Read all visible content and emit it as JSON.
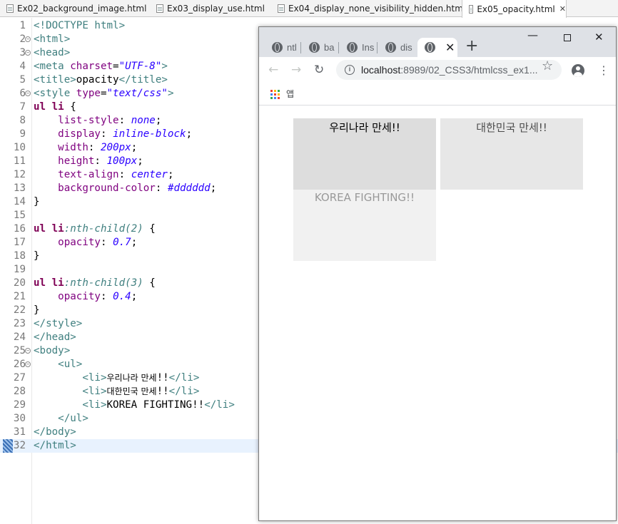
{
  "editor_tabs": [
    {
      "label": "Ex02_background_image.html",
      "active": false
    },
    {
      "label": "Ex03_display_use.html",
      "active": false
    },
    {
      "label": "Ex04_display_none_visibility_hidden.html",
      "active": false
    },
    {
      "label": "Ex05_opacity.html",
      "active": true,
      "close": "✕"
    }
  ],
  "code_lines": [
    {
      "n": "1",
      "fold": false,
      "parts": [
        [
          "t-tag",
          "<!DOCTYPE html>"
        ]
      ]
    },
    {
      "n": "2",
      "fold": true,
      "parts": [
        [
          "t-tag",
          "<html>"
        ]
      ]
    },
    {
      "n": "3",
      "fold": true,
      "parts": [
        [
          "t-tag",
          "<head>"
        ]
      ]
    },
    {
      "n": "4",
      "fold": false,
      "parts": [
        [
          "t-tag",
          "<meta "
        ],
        [
          "t-attr",
          "charset"
        ],
        [
          "t-txt",
          "="
        ],
        [
          "t-str",
          "\"UTF-8\""
        ],
        [
          "t-tag",
          ">"
        ]
      ]
    },
    {
      "n": "5",
      "fold": false,
      "parts": [
        [
          "t-tag",
          "<title>"
        ],
        [
          "t-txt",
          "opacity"
        ],
        [
          "t-tag",
          "</title>"
        ]
      ]
    },
    {
      "n": "6",
      "fold": true,
      "parts": [
        [
          "t-tag",
          "<style "
        ],
        [
          "t-attr",
          "type"
        ],
        [
          "t-txt",
          "="
        ],
        [
          "t-str",
          "\"text/css\""
        ],
        [
          "t-tag",
          ">"
        ]
      ]
    },
    {
      "n": "7",
      "fold": false,
      "parts": [
        [
          "t-sel",
          "ul li"
        ],
        [
          "t-txt",
          " {"
        ]
      ]
    },
    {
      "n": "8",
      "fold": false,
      "parts": [
        [
          "t-txt",
          "    "
        ],
        [
          "t-prop",
          "list-style"
        ],
        [
          "t-txt",
          ": "
        ],
        [
          "t-val",
          "none"
        ],
        [
          "t-txt",
          ";"
        ]
      ]
    },
    {
      "n": "9",
      "fold": false,
      "parts": [
        [
          "t-txt",
          "    "
        ],
        [
          "t-prop",
          "display"
        ],
        [
          "t-txt",
          ": "
        ],
        [
          "t-val",
          "inline-block"
        ],
        [
          "t-txt",
          ";"
        ]
      ]
    },
    {
      "n": "10",
      "fold": false,
      "parts": [
        [
          "t-txt",
          "    "
        ],
        [
          "t-prop",
          "width"
        ],
        [
          "t-txt",
          ": "
        ],
        [
          "t-val",
          "200px"
        ],
        [
          "t-txt",
          ";"
        ]
      ]
    },
    {
      "n": "11",
      "fold": false,
      "parts": [
        [
          "t-txt",
          "    "
        ],
        [
          "t-prop",
          "height"
        ],
        [
          "t-txt",
          ": "
        ],
        [
          "t-val",
          "100px"
        ],
        [
          "t-txt",
          ";"
        ]
      ]
    },
    {
      "n": "12",
      "fold": false,
      "parts": [
        [
          "t-txt",
          "    "
        ],
        [
          "t-prop",
          "text-align"
        ],
        [
          "t-txt",
          ": "
        ],
        [
          "t-val",
          "center"
        ],
        [
          "t-txt",
          ";"
        ]
      ]
    },
    {
      "n": "13",
      "fold": false,
      "parts": [
        [
          "t-txt",
          "    "
        ],
        [
          "t-prop",
          "background-color"
        ],
        [
          "t-txt",
          ": "
        ],
        [
          "t-val",
          "#dddddd"
        ],
        [
          "t-txt",
          ";"
        ]
      ]
    },
    {
      "n": "14",
      "fold": false,
      "parts": [
        [
          "t-txt",
          "}"
        ]
      ]
    },
    {
      "n": "15",
      "fold": false,
      "parts": []
    },
    {
      "n": "16",
      "fold": false,
      "parts": [
        [
          "t-sel",
          "ul li"
        ],
        [
          "t-pseudo",
          ":nth-child(2)"
        ],
        [
          "t-txt",
          " {"
        ]
      ]
    },
    {
      "n": "17",
      "fold": false,
      "parts": [
        [
          "t-txt",
          "    "
        ],
        [
          "t-prop",
          "opacity"
        ],
        [
          "t-txt",
          ": "
        ],
        [
          "t-val",
          "0.7"
        ],
        [
          "t-txt",
          ";"
        ]
      ]
    },
    {
      "n": "18",
      "fold": false,
      "parts": [
        [
          "t-txt",
          "}"
        ]
      ]
    },
    {
      "n": "19",
      "fold": false,
      "parts": []
    },
    {
      "n": "20",
      "fold": false,
      "parts": [
        [
          "t-sel",
          "ul li"
        ],
        [
          "t-pseudo",
          ":nth-child(3)"
        ],
        [
          "t-txt",
          " {"
        ]
      ]
    },
    {
      "n": "21",
      "fold": false,
      "parts": [
        [
          "t-txt",
          "    "
        ],
        [
          "t-prop",
          "opacity"
        ],
        [
          "t-txt",
          ": "
        ],
        [
          "t-val",
          "0.4"
        ],
        [
          "t-txt",
          ";"
        ]
      ]
    },
    {
      "n": "22",
      "fold": false,
      "parts": [
        [
          "t-txt",
          "}"
        ]
      ]
    },
    {
      "n": "23",
      "fold": false,
      "parts": [
        [
          "t-tag",
          "</style>"
        ]
      ]
    },
    {
      "n": "24",
      "fold": false,
      "parts": [
        [
          "t-tag",
          "</head>"
        ]
      ]
    },
    {
      "n": "25",
      "fold": true,
      "parts": [
        [
          "t-tag",
          "<body>"
        ]
      ]
    },
    {
      "n": "26",
      "fold": true,
      "parts": [
        [
          "t-txt",
          "    "
        ],
        [
          "t-tag",
          "<ul>"
        ]
      ]
    },
    {
      "n": "27",
      "fold": false,
      "parts": [
        [
          "t-txt",
          "        "
        ],
        [
          "t-tag",
          "<li>"
        ],
        [
          "t-txt t-kr",
          "우리나라 만세"
        ],
        [
          "t-txt",
          "!!"
        ],
        [
          "t-tag",
          "</li>"
        ]
      ]
    },
    {
      "n": "28",
      "fold": false,
      "parts": [
        [
          "t-txt",
          "        "
        ],
        [
          "t-tag",
          "<li>"
        ],
        [
          "t-txt t-kr",
          "대한민국 만세"
        ],
        [
          "t-txt",
          "!!"
        ],
        [
          "t-tag",
          "</li>"
        ]
      ]
    },
    {
      "n": "29",
      "fold": false,
      "parts": [
        [
          "t-txt",
          "        "
        ],
        [
          "t-tag",
          "<li>"
        ],
        [
          "t-txt",
          "KOREA FIGHTING!!"
        ],
        [
          "t-tag",
          "</li>"
        ]
      ]
    },
    {
      "n": "30",
      "fold": false,
      "parts": [
        [
          "t-txt",
          "    "
        ],
        [
          "t-tag",
          "</ul>"
        ]
      ]
    },
    {
      "n": "31",
      "fold": false,
      "parts": [
        [
          "t-tag",
          "</body>"
        ]
      ]
    },
    {
      "n": "32",
      "fold": false,
      "current": true,
      "parts": [
        [
          "t-tag",
          "</html>"
        ]
      ]
    }
  ],
  "browser": {
    "tabs": [
      {
        "label": "ntl",
        "active": false
      },
      {
        "label": "ba",
        "active": false
      },
      {
        "label": "Ins",
        "active": false
      },
      {
        "label": "dis",
        "active": false
      },
      {
        "label": "",
        "active": true,
        "close": "✕"
      }
    ],
    "new_tab": "+",
    "window_controls": {
      "minimize": "—",
      "close": "✕"
    },
    "nav": {
      "back": "←",
      "forward": "→",
      "reload": "↻",
      "star": "☆",
      "menu": "⋮"
    },
    "info_icon": "i",
    "url_host": "localhost",
    "url_rest": ":8989/02_CSS3/htmlcss_ex1...",
    "bookmarks_label": "앱",
    "apps_colors": [
      "#ea4335",
      "#fbbc04",
      "#34a853",
      "#4285f4",
      "#ea4335",
      "#fbbc04",
      "#34a853",
      "#4285f4",
      "#ea4335"
    ]
  },
  "demo": {
    "items": [
      {
        "text": "우리나라 만세!!",
        "opacity": 1.0
      },
      {
        "text": "대한민국 만세!!",
        "opacity": 0.7
      },
      {
        "text": "KOREA FIGHTING!!",
        "opacity": 0.4
      }
    ],
    "background": "#dddddd"
  }
}
